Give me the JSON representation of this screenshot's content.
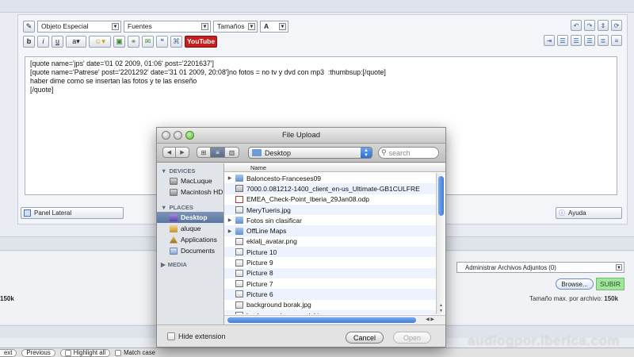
{
  "toolbar": {
    "special_object": "Objeto Especial",
    "fonts": "Fuentes",
    "sizes": "Tamaños",
    "font_color": "A",
    "bold": "b",
    "italic": "i",
    "underline": "u",
    "youtube": "YouTube"
  },
  "editor": {
    "lines": [
      "[quote name='jps' date='01 02 2009, 01:06' post='2201637']",
      "[quote name='Patrese' post='2201292' date='31 01 2009, 20:08']no fotos = no tv y dvd con mp3  :thumbsup:[/quote]",
      "haber dime como se insertan las fotos y te las enseño",
      "[/quote]"
    ],
    "panel_button": "Panel Lateral",
    "help_button": "Ayuda"
  },
  "attachments": {
    "select_value": "Administrar Archivos Adjuntos (0)",
    "browse": "Browse...",
    "upload": "SUBIR",
    "max_size_label": "Tamaño max. por archivo:",
    "max_size_value": "150k",
    "left_size": "150k"
  },
  "findbar": {
    "next": "ext",
    "previous": "Previous",
    "highlight": "Highlight all",
    "match_case": "Match case"
  },
  "watermark": "audiogpor.iberica.com",
  "dialog": {
    "title": "File Upload",
    "location": "Desktop",
    "search_placeholder": "search",
    "column_name": "Name",
    "sidebar": {
      "devices_heading": "DEVICES",
      "devices": [
        "MacLuque",
        "Macintosh HD"
      ],
      "places_heading": "PLACES",
      "places": [
        "Desktop",
        "aluque",
        "Applications",
        "Documents"
      ],
      "media_heading": "MEDIA"
    },
    "files": [
      {
        "name": "Baloncesto-Franceses09",
        "kind": "folder",
        "expandable": true
      },
      {
        "name": "7000.0.081212-1400_client_en-us_Ultimate-GB1CULFRE",
        "kind": "package",
        "expandable": false
      },
      {
        "name": "EMEA_Check-Point_Iberia_29Jan08.odp",
        "kind": "document",
        "expandable": false
      },
      {
        "name": "MeryTueris.jpg",
        "kind": "image",
        "expandable": false
      },
      {
        "name": "Fotos sin clasificar",
        "kind": "folder",
        "expandable": true
      },
      {
        "name": "OffLine Maps",
        "kind": "folder",
        "expandable": true
      },
      {
        "name": "eklalj_avatar.png",
        "kind": "image",
        "expandable": false
      },
      {
        "name": "Picture 10",
        "kind": "image",
        "expandable": false
      },
      {
        "name": "Picture 9",
        "kind": "image",
        "expandable": false
      },
      {
        "name": "Picture 8",
        "kind": "image",
        "expandable": false
      },
      {
        "name": "Picture 7",
        "kind": "image",
        "expandable": false
      },
      {
        "name": "Picture 6",
        "kind": "image",
        "expandable": false
      },
      {
        "name": "background borak.jpg",
        "kind": "image",
        "expandable": false
      },
      {
        "name": "background euromodal.jpg",
        "kind": "image",
        "expandable": false
      }
    ],
    "hide_extension": "Hide extension",
    "cancel": "Cancel",
    "open": "Open"
  }
}
